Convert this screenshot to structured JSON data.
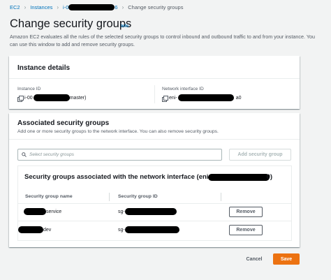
{
  "breadcrumb": {
    "items": [
      "EC2",
      "Instances",
      "i-0",
      "6",
      "Change security groups"
    ]
  },
  "header": {
    "title": "Change security groups",
    "info": "Info",
    "description": "Amazon EC2 evaluates all the rules of the selected security groups to control inbound and outbound traffic to and from your instance. You can use this window to add and remove security groups."
  },
  "instance_details": {
    "heading": "Instance details",
    "instance_id_label": "Instance ID",
    "instance_id_prefix": "i-00",
    "instance_id_suffix": "master)",
    "eni_label": "Network interface ID",
    "eni_prefix": "eni-",
    "eni_suffix": "a0"
  },
  "associated": {
    "heading": "Associated security groups",
    "description": "Add one or more security groups to the network interface. You can also remove security groups.",
    "search_placeholder": "Select security groups",
    "add_button": "Add security group",
    "table_title_prefix": "Security groups associated with the network interface (eni-",
    "table_title_suffix": "0)",
    "columns": [
      "Security group name",
      "Security group ID"
    ],
    "rows": [
      {
        "name_suffix": "service",
        "id_prefix": "sg-",
        "action": "Remove"
      },
      {
        "name_suffix": "dev",
        "id_prefix": "sg-",
        "action": "Remove"
      }
    ]
  },
  "footer": {
    "cancel": "Cancel",
    "save": "Save"
  },
  "colors": {
    "accent": "#ec7211",
    "link": "#0073bb",
    "background": "#f2f3f3",
    "redaction": "#000000"
  }
}
